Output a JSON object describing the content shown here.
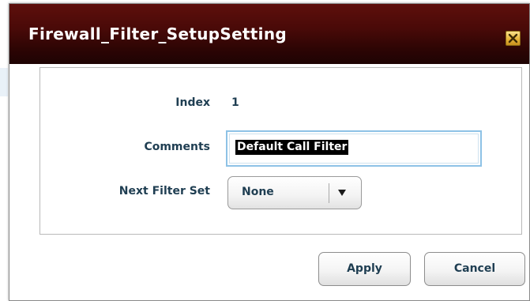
{
  "dialog": {
    "title": "Firewall_Filter_SetupSetting",
    "close_icon": "close-icon"
  },
  "form": {
    "index": {
      "label": "Index",
      "value": "1"
    },
    "comments": {
      "label": "Comments",
      "value": "Default Call Filter"
    },
    "next_filter_set": {
      "label": "Next Filter Set",
      "selected": "None",
      "icon": "dropdown-arrow-icon"
    }
  },
  "buttons": {
    "apply": "Apply",
    "cancel": "Cancel"
  },
  "colors": {
    "titlebar": "#4a0a08",
    "label_text": "#1f3e52",
    "input_focus_border": "#8ec2e6",
    "close_button": "#e7b53b"
  }
}
